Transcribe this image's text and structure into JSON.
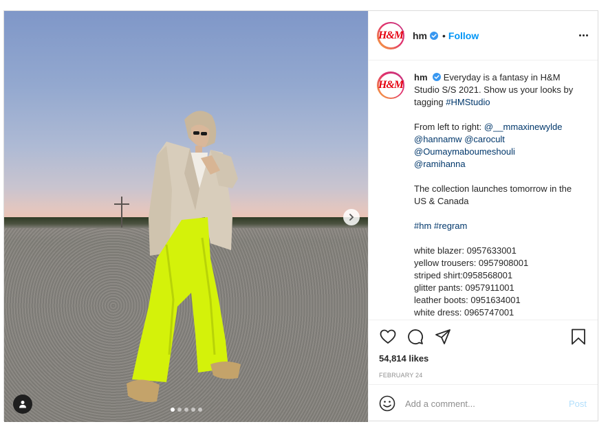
{
  "account": {
    "username": "hm",
    "logo_text": "H&M",
    "follow_label": "Follow",
    "separator": "•"
  },
  "caption": {
    "username": "hm",
    "lines": [
      "Everyday is a fantasy in H&M Studio S/S 2021. Show us your looks by tagging ",
      "#HMStudio",
      "From left to right: ",
      "@__mmaxinewylde",
      "@hannamw",
      "@carocult",
      "@Oumaymaboumeshouli",
      "@ramihanna",
      "The collection launches tomorrow in the US & Canada",
      "#hm",
      "#regram",
      "white blazer: 0957633001",
      "yellow trousers: 0957908001",
      "striped shirt:0958568001",
      "glitter pants: 0957911001",
      "leather boots: 0951634001",
      "white dress: 0965747001"
    ]
  },
  "engagement": {
    "likes": "54,814 likes",
    "date": "FEBRUARY 24"
  },
  "comment": {
    "placeholder": "Add a comment...",
    "post_label": "Post"
  },
  "carousel": {
    "slide_count": 5,
    "active_index": 0
  },
  "colors": {
    "accent": "#0095f6",
    "link": "#00376b",
    "brand_red": "#e50010",
    "trouser_neon": "#d4f20a",
    "blazer_beige": "#d8cdbb"
  },
  "icons": [
    "verified-badge-icon",
    "more-options-icon",
    "chevron-right-icon",
    "user-tag-icon",
    "heart-icon",
    "comment-icon",
    "share-icon",
    "bookmark-icon",
    "emoji-icon"
  ]
}
